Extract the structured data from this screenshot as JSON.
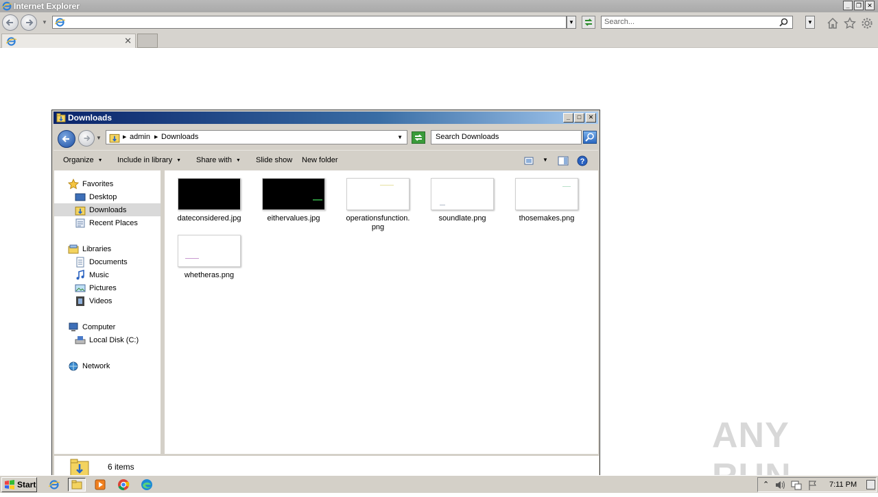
{
  "ie": {
    "title": "Internet Explorer",
    "address_value": "",
    "search_placeholder": "Search...",
    "tab_label": ""
  },
  "explorer": {
    "title": "Downloads",
    "breadcrumb": [
      "admin",
      "Downloads"
    ],
    "search_placeholder": "Search Downloads",
    "toolbar": {
      "organize": "Organize",
      "include_in_library": "Include in library",
      "share_with": "Share with",
      "slide_show": "Slide show",
      "new_folder": "New folder"
    },
    "nav": {
      "favorites": "Favorites",
      "desktop": "Desktop",
      "downloads": "Downloads",
      "recent_places": "Recent Places",
      "libraries": "Libraries",
      "documents": "Documents",
      "music": "Music",
      "pictures": "Pictures",
      "videos": "Videos",
      "computer": "Computer",
      "local_disk": "Local Disk (C:)",
      "network": "Network"
    },
    "files": [
      {
        "name": "dateconsidered.jpg",
        "thumb": "dark"
      },
      {
        "name": "eithervalues.jpg",
        "thumb": "dark"
      },
      {
        "name": "operationsfunction.\npng",
        "thumb": "light"
      },
      {
        "name": "soundlate.png",
        "thumb": "light"
      },
      {
        "name": "thosemakes.png",
        "thumb": "light"
      },
      {
        "name": "whetheras.png",
        "thumb": "light"
      }
    ],
    "status": "6 items"
  },
  "taskbar": {
    "start_label": "Start",
    "clock": "7:11 PM"
  },
  "watermark": "ANY RUN",
  "colors": {
    "explorer_title_start": "#0a246a",
    "explorer_title_end": "#a6caf0",
    "chrome_gray": "#d4d0c8",
    "nav_selected": "#d9d9d9"
  }
}
